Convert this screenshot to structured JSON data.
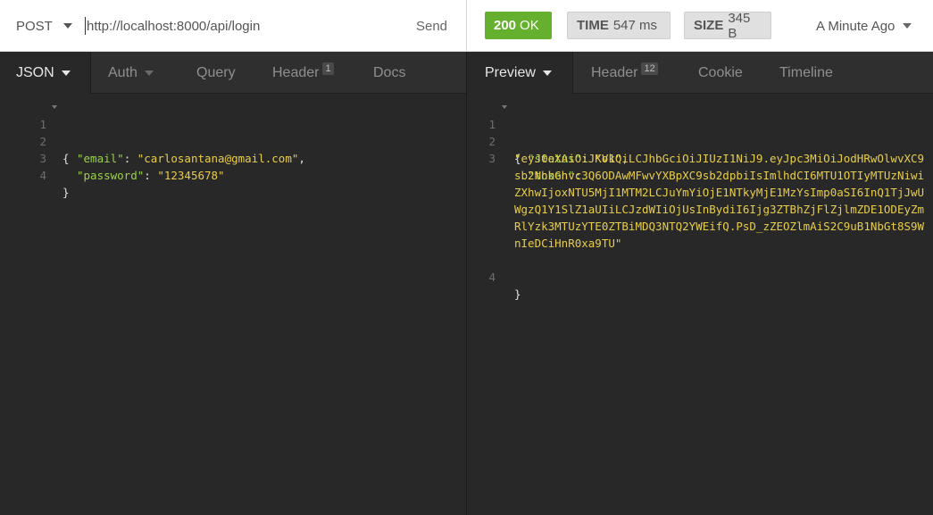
{
  "request": {
    "method": "POST",
    "url": "http://localhost:8000/api/login",
    "send_label": "Send"
  },
  "response_meta": {
    "status_code": "200",
    "status_text": "OK",
    "time_label": "TIME",
    "time_value": "547 ms",
    "size_label": "SIZE",
    "size_value": "345 B",
    "history": "A Minute Ago"
  },
  "left_tabs": [
    {
      "label": "JSON"
    },
    {
      "label": "Auth"
    },
    {
      "label": "Query"
    },
    {
      "label": "Header",
      "count": "1"
    },
    {
      "label": "Docs"
    }
  ],
  "right_tabs": [
    {
      "label": "Preview"
    },
    {
      "label": "Header",
      "count": "12"
    },
    {
      "label": "Cookie"
    },
    {
      "label": "Timeline"
    }
  ],
  "request_body": {
    "line_numbers": [
      "1",
      "2",
      "3",
      "4"
    ],
    "open_brace": "{",
    "close_brace": "}",
    "email_key": "\"email\"",
    "email_value": "\"carlosantana@gmail.com\"",
    "password_key": "\"password\"",
    "password_value": "\"12345678\""
  },
  "response_body": {
    "line_numbers": [
      "1",
      "2",
      "3",
      "4"
    ],
    "open_brace": "{",
    "close_brace": "}",
    "status_key": "\"status\"",
    "status_value": "\"ok\"",
    "token_key": "\"token\"",
    "token_value": "\"eyJ0eXAiOiJKV1QiLCJhbGciOiJIUzI1NiJ9.eyJpc3MiOiJodHRwOlwvXC9sb2NhbGhvc3Q6ODAwMFwvYXBpXC9sb2dpbiIsImlhdCI6MTU1OTIyMTUzNiwiZXhwIjoxNTU5MjI1MTM2LCJuYmYiOjE1NTkyMjE1MzYsImp0aSI6InQ1TjJwUWgzQ1Y1SlZ1aUIiLCJzdWIiOjUsInBydiI6Ijg3ZTBhZjFlZjlmZDE1ODEyZmRlYzk3MTUzYTE0ZTBiMDQ3NTQ2YWEifQ.PsD_zZEOZlmAiS2C9uB1NbGt8S9WnIeDCiHnR0xa9TU\""
  },
  "colors": {
    "status_ok": "#66b030",
    "json_key": "#9ad14a",
    "json_string": "#e8cd4a",
    "pane_bg": "#282828"
  }
}
